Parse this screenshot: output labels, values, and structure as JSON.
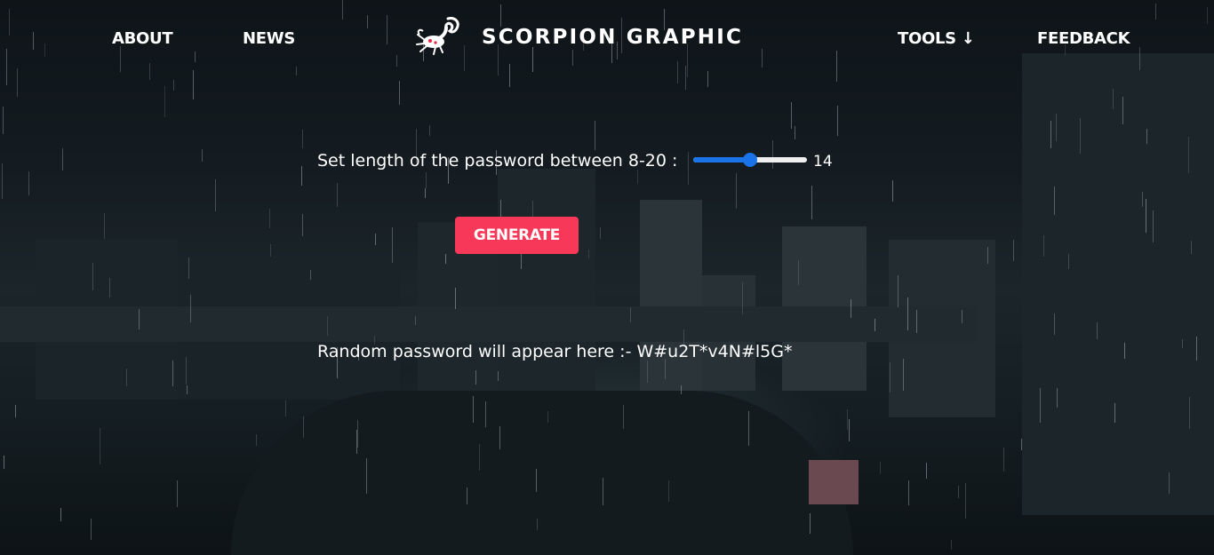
{
  "nav": {
    "about": "ABOUT",
    "news": "NEWS",
    "brand": "SCORPION GRAPHIC",
    "tools": "TOOLS ↓",
    "feedback": "FEEDBACK"
  },
  "icons": {
    "logo": "scorpion-icon"
  },
  "generator": {
    "length_label": "Set length of the password between 8-20 :",
    "length_min": 8,
    "length_max": 20,
    "length_value": "14",
    "generate_label": "GENERATE",
    "result_prefix": "Random password will appear here :-",
    "password": "W#u2T*v4N#l5G*"
  },
  "colors": {
    "button": "#f73859",
    "slider_accent": "#1a73e8",
    "text": "#ffffff"
  }
}
